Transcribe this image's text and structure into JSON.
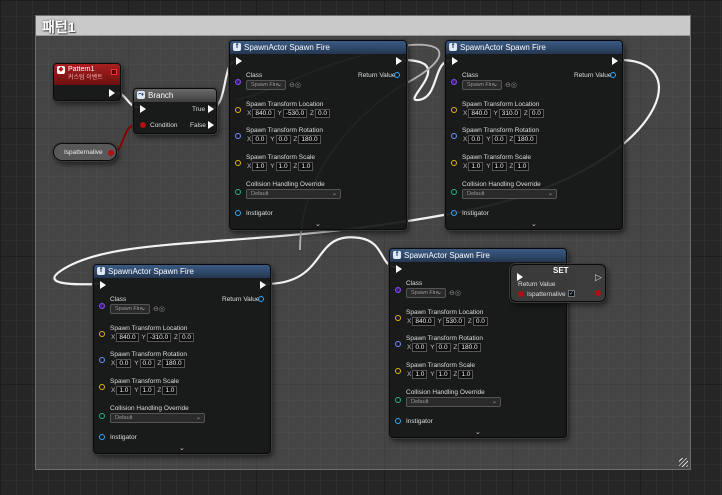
{
  "comment": {
    "title": "패턴1"
  },
  "event": {
    "title": "Pattern1",
    "subtitle": "커스텀 이벤트"
  },
  "branch": {
    "title": "Branch",
    "true_label": "True",
    "false_label": "False",
    "condition_label": "Condition"
  },
  "variable_getter": {
    "label": "Ispatternalive"
  },
  "setter": {
    "title": "SET",
    "return_label": "Return Value",
    "var_label": "Ispatternalive"
  },
  "labels": {
    "class": "Class",
    "return_value": "Return Value",
    "loc": "Spawn Transform Location",
    "rot": "Spawn Transform Rotation",
    "scale": "Spawn Transform Scale",
    "collision": "Collision Handling Override",
    "instigator": "Instigator",
    "x": "X",
    "y": "Y",
    "z": "Z"
  },
  "spawn_nodes": [
    {
      "title": "SpawnActor Spawn Fire",
      "class_value": "Spawn Fire",
      "collision_value": "Default",
      "location": [
        "840.0",
        "-530.0",
        "0.0"
      ],
      "rotation": [
        "0.0",
        "0.0",
        "180.0"
      ],
      "scale": [
        "1.0",
        "1.0",
        "1.0"
      ]
    },
    {
      "title": "SpawnActor Spawn Fire",
      "class_value": "Spawn Fire",
      "collision_value": "Default",
      "location": [
        "840.0",
        "310.0",
        "0.0"
      ],
      "rotation": [
        "0.0",
        "0.0",
        "180.0"
      ],
      "scale": [
        "1.0",
        "1.0",
        "1.0"
      ]
    },
    {
      "title": "SpawnActor Spawn Fire",
      "class_value": "Spawn Fire",
      "collision_value": "Default",
      "location": [
        "840.0",
        "-310.0",
        "0.0"
      ],
      "rotation": [
        "0.0",
        "0.0",
        "180.0"
      ],
      "scale": [
        "1.0",
        "1.0",
        "1.0"
      ]
    },
    {
      "title": "SpawnActor Spawn Fire",
      "class_value": "Spawn Fire",
      "collision_value": "Default",
      "location": [
        "840.0",
        "530.0",
        "0.0"
      ],
      "rotation": [
        "0.0",
        "0.0",
        "180.0"
      ],
      "scale": [
        "1.0",
        "1.0",
        "1.0"
      ]
    }
  ],
  "colors": {
    "exec_wire": "#f2f2f2",
    "bool_wire": "#8a0000",
    "event_header": "#a82020",
    "spawn_header": "#2d4566"
  }
}
